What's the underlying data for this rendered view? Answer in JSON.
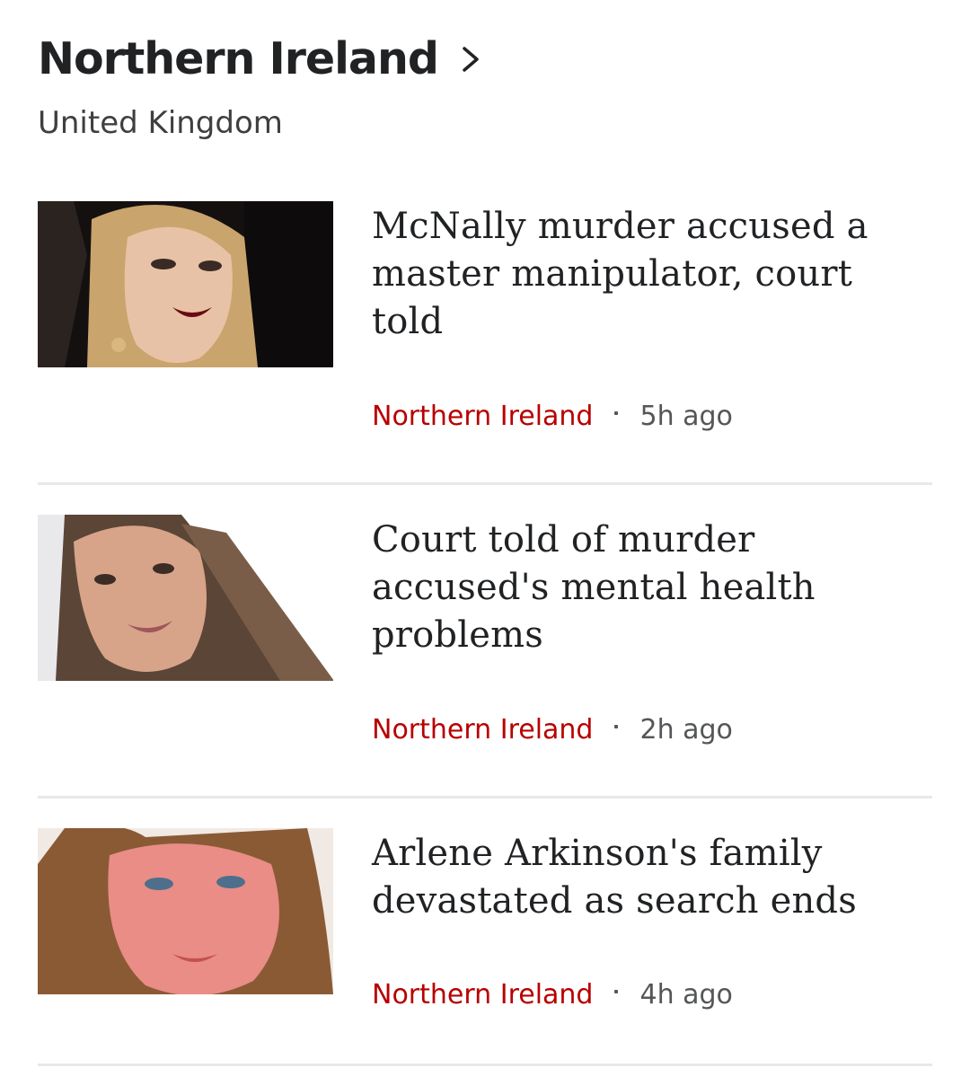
{
  "section": {
    "title": "Northern Ireland",
    "subtitle": "United Kingdom",
    "chevron_icon": "chevron-right-icon"
  },
  "stories": [
    {
      "headline": "McNally murder accused a master manipulator, court told",
      "tag": "Northern Ireland",
      "time": "5h ago"
    },
    {
      "headline": "Court told of murder accused's mental health problems",
      "tag": "Northern Ireland",
      "time": "2h ago"
    },
    {
      "headline": "Arlene Arkinson's family devastated as search ends",
      "tag": "Northern Ireland",
      "time": "4h ago"
    }
  ],
  "colors": {
    "tag": "#b80000",
    "text": "#202224",
    "meta": "#545658",
    "divider": "#e6e8ea"
  }
}
